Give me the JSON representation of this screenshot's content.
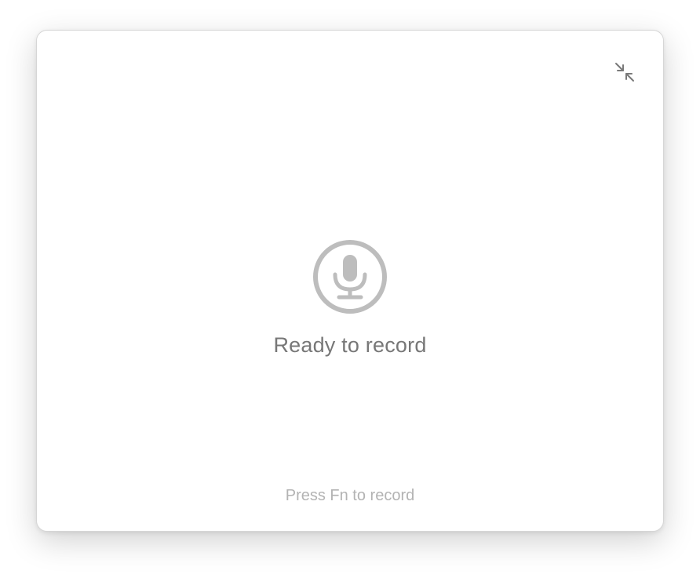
{
  "window": {
    "status_label": "Ready to record",
    "hint_label": "Press Fn to record"
  },
  "icons": {
    "collapse": "collapse-arrows-icon",
    "microphone": "microphone-icon"
  },
  "colors": {
    "icon_gray": "#bdbdbd",
    "collapse_icon": "#7a7a7a",
    "status_text": "#777777",
    "hint_text": "#b3b3b3"
  }
}
